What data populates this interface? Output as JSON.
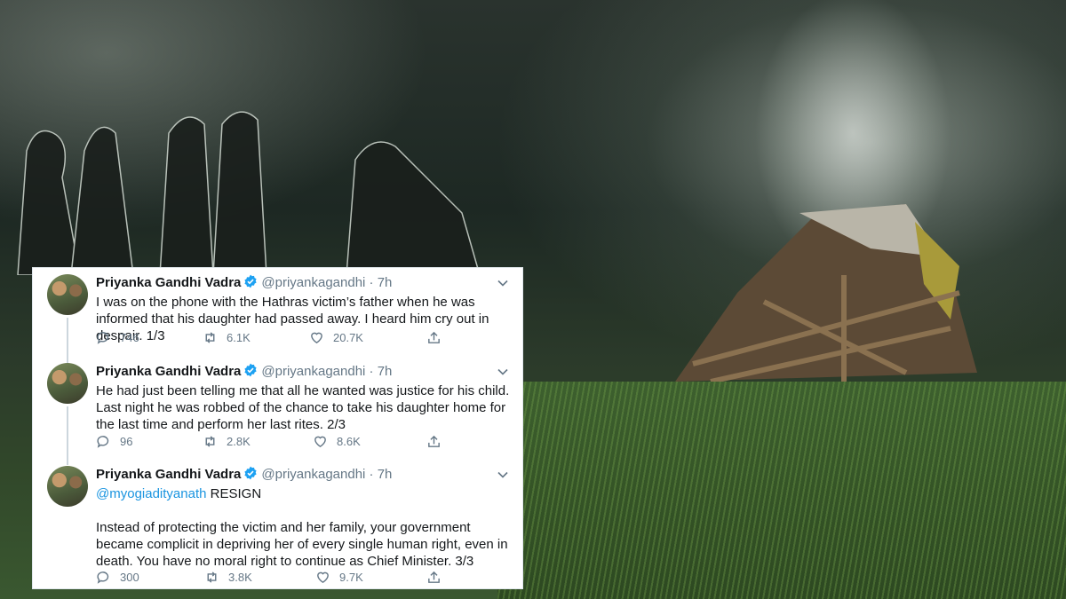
{
  "tweets": [
    {
      "name": "Priyanka Gandhi Vadra",
      "handle": "@priyankagandhi",
      "time": "7h",
      "text": "I was on the phone with the Hathras victim’s father when he was informed that his daughter had passed away. I heard him cry out in despair. 1/3",
      "replies": "746",
      "retweets": "6.1K",
      "likes": "20.7K"
    },
    {
      "name": "Priyanka Gandhi Vadra",
      "handle": "@priyankagandhi",
      "time": "7h",
      "text": "He had just been telling me that all he wanted was justice for his child. Last night he was robbed of the chance to take his daughter home for the last time and perform her last rites. 2/3",
      "replies": "96",
      "retweets": "2.8K",
      "likes": "8.6K"
    },
    {
      "name": "Priyanka Gandhi Vadra",
      "handle": "@priyankagandhi",
      "time": "7h",
      "mention": "@myogiadityanath",
      "mention_suffix": " RESIGN",
      "text": "Instead of protecting the victim and her family, your government became complicit in depriving her of every single human right, even in death. You have no moral right to continue as Chief Minister. 3/3",
      "replies": "300",
      "retweets": "3.8K",
      "likes": "9.7K"
    }
  ],
  "separator": "·",
  "colors": {
    "verified": "#1da1f2",
    "link": "#1b95e0",
    "muted": "#657786"
  },
  "icons": {
    "verified": "verified-badge-icon",
    "caret": "chevron-down-icon",
    "reply": "reply-icon",
    "retweet": "retweet-icon",
    "like": "heart-icon",
    "share": "share-icon"
  }
}
